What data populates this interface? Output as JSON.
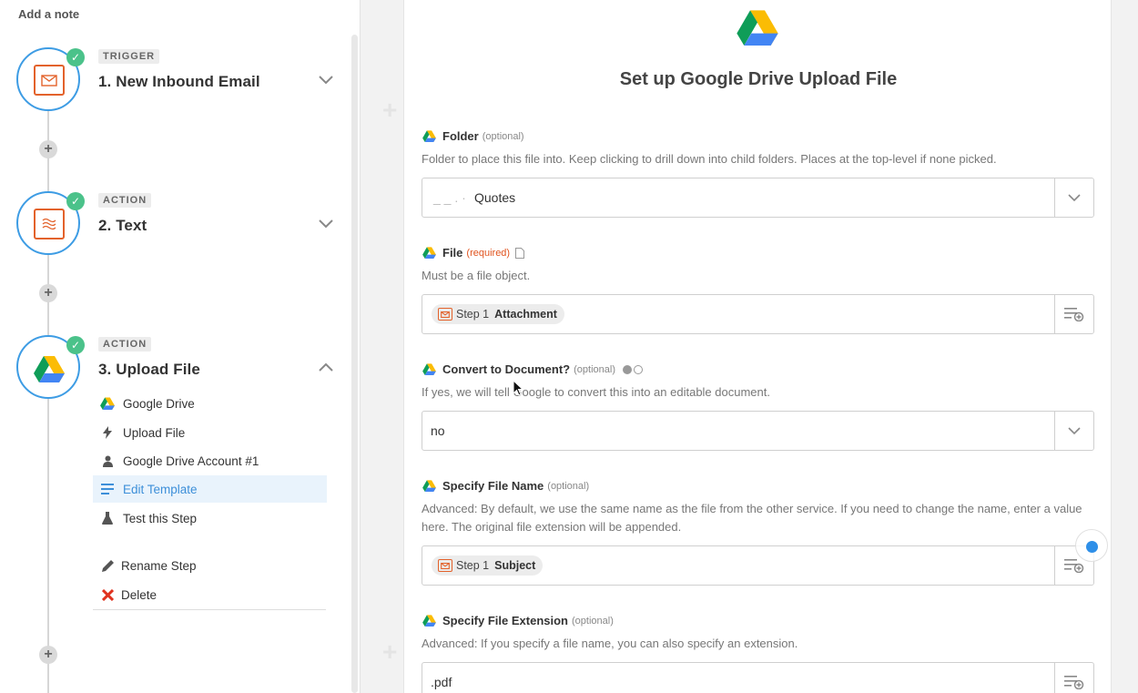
{
  "sidebar": {
    "add_note": "Add a note",
    "steps": [
      {
        "tag": "TRIGGER",
        "title": "1. New Inbound Email",
        "icon": "email-icon"
      },
      {
        "tag": "ACTION",
        "title": "2. Text",
        "icon": "formatter-icon"
      },
      {
        "tag": "ACTION",
        "title": "3. Upload File",
        "icon": "google-drive-icon"
      }
    ],
    "sub_items": [
      {
        "label": "Google Drive",
        "icon": "google-drive-icon"
      },
      {
        "label": "Upload File",
        "icon": "lightning-icon"
      },
      {
        "label": "Google Drive Account #1",
        "icon": "person-icon"
      },
      {
        "label": "Edit Template",
        "icon": "lines-icon",
        "active": true
      },
      {
        "label": "Test this Step",
        "icon": "flask-icon"
      },
      {
        "label": "Rename Step",
        "icon": "pencil-icon"
      },
      {
        "label": "Delete",
        "icon": "x-icon"
      }
    ]
  },
  "main": {
    "title": "Set up Google Drive Upload File",
    "fields": {
      "folder": {
        "label": "Folder",
        "badge": "(optional)",
        "help": "Folder to place this file into. Keep clicking to drill down into child folders. Places at the top-level if none picked.",
        "value": "Quotes"
      },
      "file": {
        "label": "File",
        "badge": "(required)",
        "help": "Must be a file object.",
        "pill_step": "Step 1",
        "pill_name": "Attachment"
      },
      "convert": {
        "label": "Convert to Document?",
        "badge": "(optional)",
        "help": "If yes, we will tell Google to convert this into an editable document.",
        "value": "no"
      },
      "filename": {
        "label": "Specify File Name",
        "badge": "(optional)",
        "help": "Advanced: By default, we use the same name as the file from the other service. If you need to change the name, enter a value here. The original file extension will be appended.",
        "pill_step": "Step 1",
        "pill_name": "Subject"
      },
      "extension": {
        "label": "Specify File Extension",
        "badge": "(optional)",
        "help": "Advanced: If you specify a file name, you can also specify an extension.",
        "value": ".pdf"
      }
    }
  },
  "colors": {
    "accent_blue": "#3d9ce4",
    "zapier_orange": "#e3622b",
    "success_green": "#4bc28a",
    "required_red": "#e0541f"
  }
}
